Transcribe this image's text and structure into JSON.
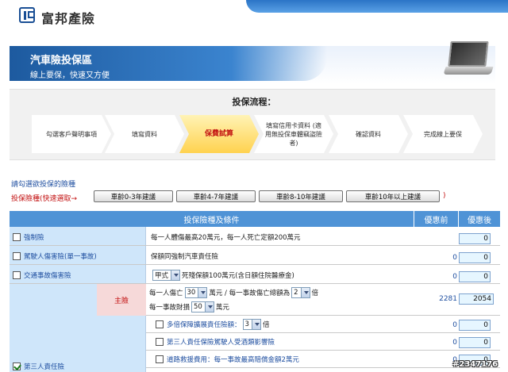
{
  "header": {
    "brand": "富邦產險",
    "logo_icon": "fubon-logo-icon"
  },
  "banner": {
    "title": "汽車險投保區",
    "subtitle": "線上要保，快速又方便",
    "illustration": "laptop-icon"
  },
  "process": {
    "title": "投保流程：",
    "steps": [
      {
        "label": "勾選客戶聲明事項",
        "active": false
      },
      {
        "label": "填寫資料",
        "active": false
      },
      {
        "label": "保費試算",
        "active": true
      },
      {
        "label": "填寫信用卡資料 (適用無投保車體竊盜險者)",
        "active": false
      },
      {
        "label": "確認資料",
        "active": false
      },
      {
        "label": "完成線上要保",
        "active": false
      }
    ]
  },
  "selection": {
    "prompt": "請勾選欲投保的險種",
    "quick_label": "投保險種(快速選取→",
    "quick_buttons": [
      "車齡0-3年建議",
      "車齡4-7年建議",
      "車齡8-10年建議",
      "車齡10年以上建議"
    ],
    "close_paren": ")"
  },
  "table": {
    "headers": {
      "type": "投保險種及條件",
      "before": "優惠前",
      "after": "優惠後"
    },
    "rows": [
      {
        "name": "強制險",
        "checked": false,
        "desc": "每一人體傷最高20萬元，每一人死亡定額200萬元",
        "before": "",
        "after": "0"
      },
      {
        "name": "駕駛人傷害險(單一事故)",
        "checked": false,
        "desc": "保額同強制汽車責任險",
        "before": "0",
        "after": "0"
      },
      {
        "name": "交通事故傷害險",
        "checked": false,
        "desc_select": "甲式",
        "desc": "死殘保額100萬元(含日額住院醫療金)",
        "before": "0",
        "after": "0"
      }
    ],
    "third_party": {
      "name": "第三人責任險",
      "checked": true,
      "main_label": "主險",
      "line1_a": "每一人傷亡",
      "line1_sel1": "30",
      "line1_b": "萬元 / 每一事故傷亡總額為",
      "line1_sel2": "2",
      "line1_c": "倍",
      "line2_a": "每一事故財損",
      "line2_sel": "50",
      "line2_b": "萬元",
      "before": "2281",
      "after": "2054",
      "sub_options": [
        {
          "label": "多倍保障擴展責任險額：",
          "select": "3",
          "suffix": "倍",
          "before": "0",
          "after": "0"
        },
        {
          "label": "第三人責任保險駕駛人受酒類影響險",
          "select": "",
          "suffix": "",
          "before": "0",
          "after": "0"
        },
        {
          "label": "道路救援費用：每一事故最高賠償金額2萬元",
          "select": "",
          "suffix": "",
          "before": "0",
          "after": "0"
        }
      ]
    }
  },
  "watermark": "#2347176",
  "colors": {
    "header_blue": "#4f93d6",
    "left_col": "#cfe6fa",
    "accent_red": "#c21010",
    "step_active": "#ffd24f"
  }
}
